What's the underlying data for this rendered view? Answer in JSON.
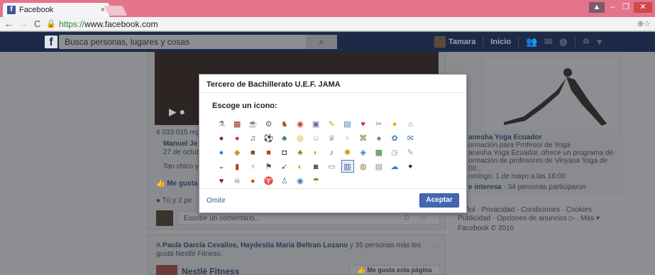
{
  "browser": {
    "tab_title": "Facebook",
    "tab_close": "×",
    "url_scheme": "https://",
    "url_rest": "www.facebook.com"
  },
  "fbbar": {
    "logo": "f",
    "search_placeholder": "Busca personas, lugares y cosas",
    "user_name": "Tamara",
    "home_label": "Inicio"
  },
  "feed": {
    "views": "4 033 015 rep",
    "post_author": "Manuel Je",
    "post_date": "27 de octub",
    "post_text": "Tan chico y",
    "like_label": "Me gusta",
    "likes_summary": "Tú y 2 pe",
    "comment_placeholder": "Escribe un comentario...",
    "social_prefix": "A ",
    "social_names": "Paula García Cevallos, Haydesita María Beltran Lozano",
    "social_suffix": " y 35 personas más les",
    "social_line2": "gusta Nestlé Fitness.",
    "page_name": "Nestlé Fitness",
    "page_like_button": "Me gusta esta página"
  },
  "right_column": {
    "event_title": "anesha Yoga Ecuador",
    "event_sub": "ormación para Profesor de Yoga",
    "event_desc1": "anesha Yoga Ecuador, ofrece un programa de",
    "event_desc2": "ormación de profesores de Vinyasa Yoga de",
    "event_desc3": "00...",
    "event_date": "omingo, 1 de mayo a las 16:00",
    "interest_label": "e interesa",
    "participants": "· 34 personas participaron",
    "footer_links1": "pañol · Privacidad · Condiciones · Cookies ·",
    "footer_links2": "Publicidad · Opciones de anuncios ▷ · Más ▾",
    "footer_copyright": "Facebook © 2016"
  },
  "modal": {
    "title": "Tercero de Bachillerato U.E.F. JAMA",
    "subtitle": "Escoge un icono:",
    "omit_label": "Omitir",
    "accept_label": "Aceptar",
    "selected_icon": "book-icon",
    "icons": [
      "flask-icon",
      "film-icon",
      "mug-icon",
      "bike-icon",
      "horse-icon",
      "cake-icon",
      "book-purple-icon",
      "pencil-icon",
      "computer-icon",
      "heart-icon",
      "wrench-icon",
      "coin-icon",
      "house-icon",
      "football-icon",
      "apple-icon",
      "music-icon",
      "soccer-ball-icon",
      "tree-icon",
      "ring-icon",
      "gamepad-icon",
      "graduation-icon",
      "lightbulb-icon",
      "trophy-icon",
      "cactus-icon",
      "globe-icon",
      "envelope-icon",
      "earth-icon",
      "leaf-icon",
      "picture-icon",
      "gift-icon",
      "camera-icon",
      "plant-icon",
      "palette-icon",
      "guitar-icon",
      "sunflower-icon",
      "shield-icon",
      "chalkboard-icon",
      "clock-icon",
      "pen-icon",
      "pizza-icon",
      "cup-icon",
      "flower-pot-icon",
      "ski-icon",
      "plane-icon",
      "cheese-icon",
      "disc-icon",
      "monitor-icon",
      "book-icon",
      "cookie-icon",
      "document-icon",
      "cloud-icon",
      "grad-cap-icon",
      "wine-icon",
      "skull-icon",
      "basketball-icon",
      "pin-icon",
      "potion-icon",
      "film-reel-icon",
      "mushroom-icon"
    ],
    "icon_glyphs": [
      "⚗",
      "▦",
      "☕",
      "⚙",
      "♞",
      "◉",
      "▣",
      "✎",
      "▤",
      "♥",
      "✂",
      "●",
      "⌂",
      "●",
      "●",
      "♫",
      "⚽",
      "♣",
      "◎",
      "☺",
      "♛",
      "♀",
      "⌘",
      "♠",
      "✿",
      "✉",
      "●",
      "◆",
      "■",
      "■",
      "◘",
      "♣",
      "◐",
      "♪",
      "✺",
      "◈",
      "▩",
      "◷",
      "✎",
      "◒",
      "▮",
      "♆",
      "⚑",
      "➹",
      "◐",
      "◙",
      "▭",
      "▥",
      "◍",
      "▤",
      "☁",
      "✦",
      "♥",
      "☠",
      "●",
      "♈",
      "♙",
      "◉",
      "☂"
    ],
    "icon_colors": [
      "#6b7b8c",
      "#8b2f2f",
      "#888",
      "#666",
      "#8b5a2b",
      "#c0392b",
      "#7d5ca0",
      "#d4a017",
      "#4a7ab5",
      "#d22",
      "#5588bb",
      "#e0b000",
      "#6a8f3a",
      "#7a2d0e",
      "#c0392b",
      "#444",
      "#333",
      "#2e7d32",
      "#c8a200",
      "#999",
      "#9aa",
      "#e0b000",
      "#7a6a20",
      "#3a8a3a",
      "#3b7bbd",
      "#3b7bbd",
      "#3b7bbd",
      "#c89b2b",
      "#7a5230",
      "#c0392b",
      "#333",
      "#6a8f3a",
      "#c8a200",
      "#8b4a1e",
      "#e08a00",
      "#3b7bbd",
      "#2e7d32",
      "#888",
      "#999",
      "#e07020",
      "#c0392b",
      "#b0892b",
      "#555",
      "#3b7bbd",
      "#d8a000",
      "#444",
      "#3b7bbd",
      "#3b5998",
      "#a0703a",
      "#888",
      "#3b7bbd",
      "#222",
      "#8b1a1a",
      "#777",
      "#c05a10",
      "#7a8a9a",
      "#3b7bbd",
      "#3b7bbd",
      "#a0703a"
    ]
  },
  "colors": {
    "overlay_grey": "#8e8f93",
    "fb_blue": "#4267b2",
    "tab_pink": "#e4748c"
  }
}
